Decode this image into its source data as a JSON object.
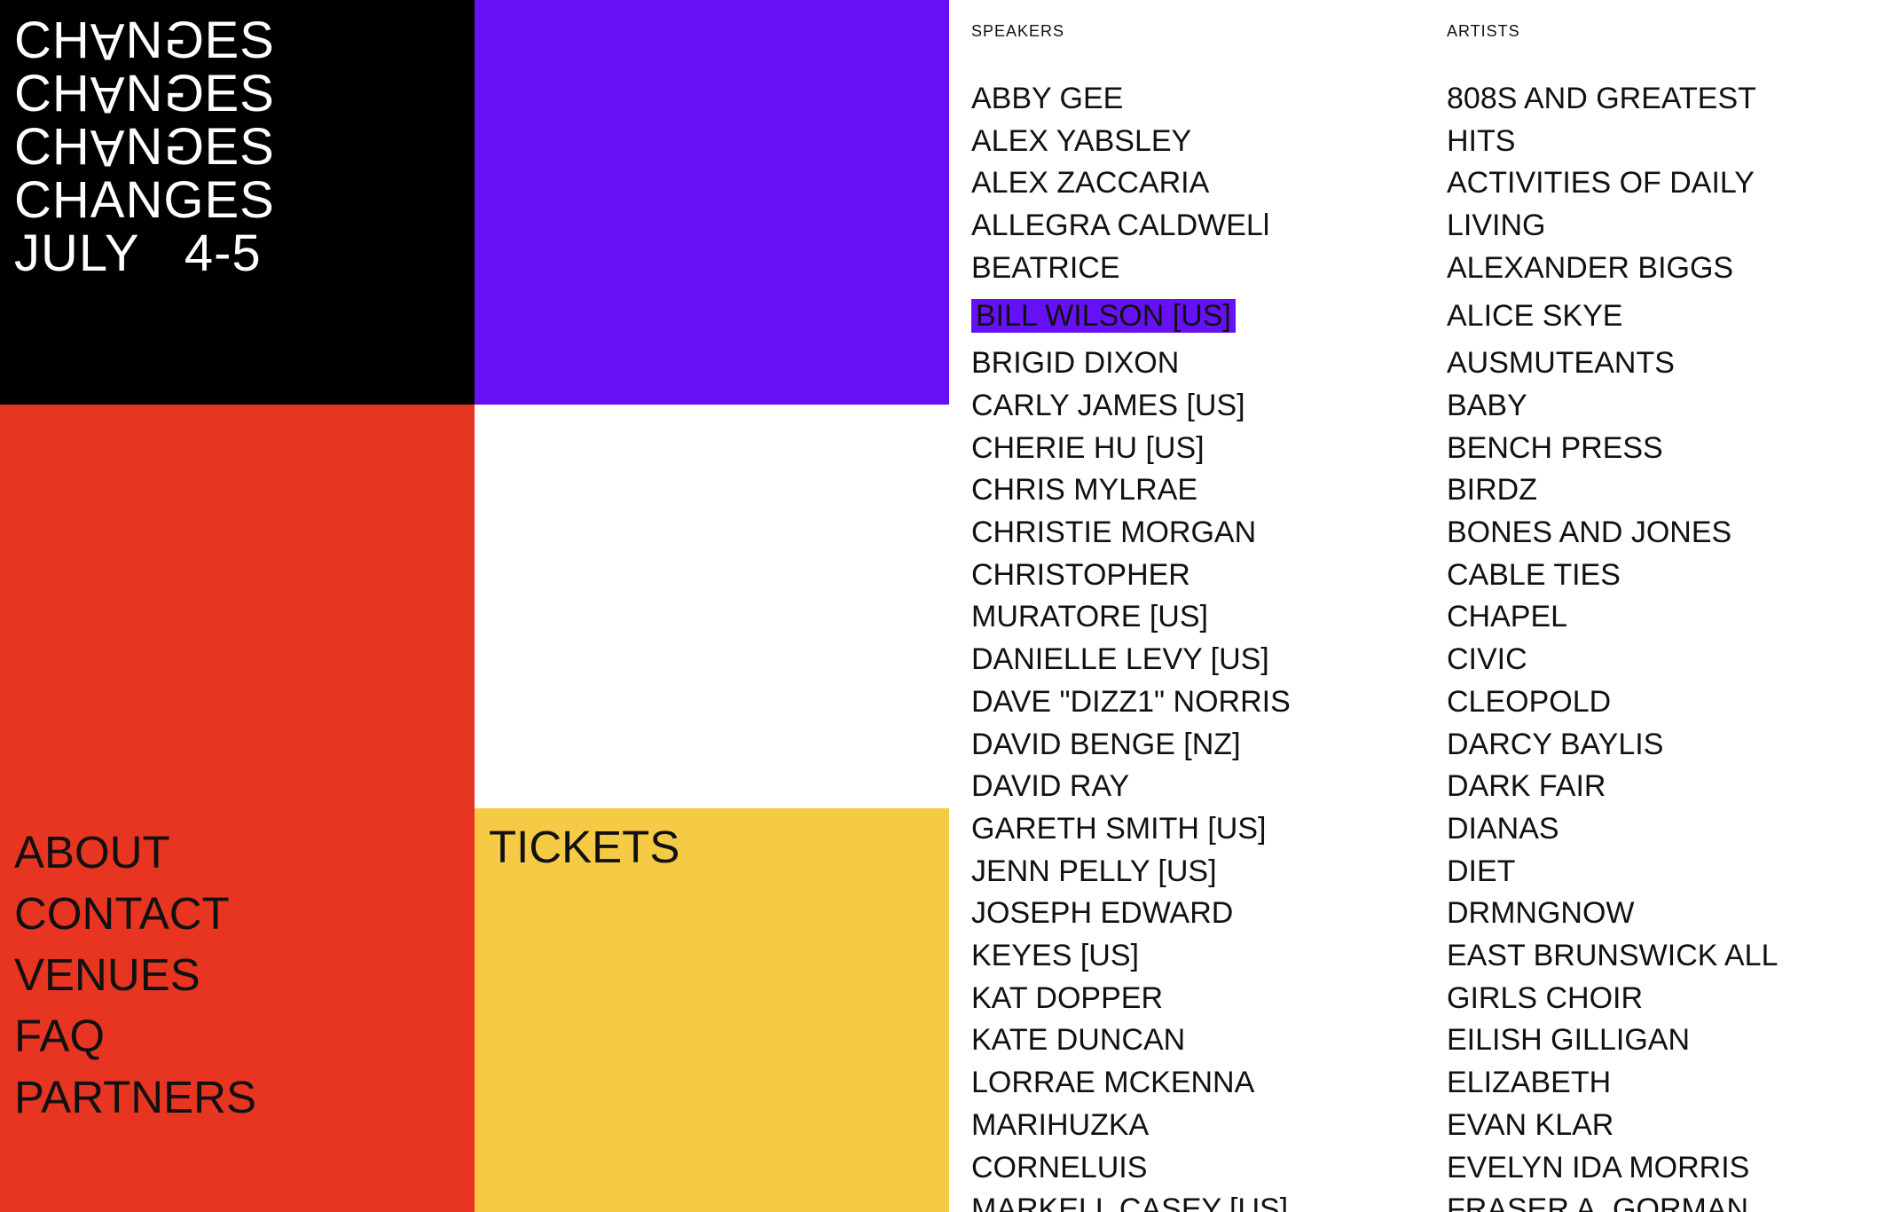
{
  "logo": {
    "line1": "CH",
    "line1_rot_a": "A",
    "line1_mid": "N",
    "line1_rot_g": "G",
    "line1_end": "ES",
    "line2": "CH",
    "line2_rot_a": "A",
    "line2_mid": "N",
    "line2_rot_g": "G",
    "line2_end": "ES",
    "line3": "CH",
    "line3_rot_a": "A",
    "line3_mid": "N",
    "line3_rot_g": "G",
    "line3_end": "ES",
    "line4": "CHANGES",
    "dates": "JULY   4-5"
  },
  "nav": {
    "items": [
      {
        "label": "ABOUT"
      },
      {
        "label": "CONTACT"
      },
      {
        "label": "VENUES"
      },
      {
        "label": "FAQ"
      },
      {
        "label": "PARTNERS"
      }
    ]
  },
  "tickets": {
    "label": "TICKETS"
  },
  "speakers": {
    "heading": "SPEAKERS",
    "items": [
      "ABBY GEE",
      "ALEX YABSLEY",
      "ALEX ZACCARIA",
      "ALLEGRA CALDWELl",
      "BEATRICE",
      "BILL WILSON [US]",
      "BRIGID DIXON",
      "CARLY JAMES [US]",
      "CHERIE HU [US]",
      "CHRIS MYLRAE",
      "CHRISTIE MORGAN",
      "CHRISTOPHER",
      "MURATORE [US]",
      "DANIELLE LEVY [US]",
      "DAVE \"DIZZ1\" NORRIS",
      "DAVID BENGE [NZ]",
      "DAVID RAY",
      "GARETH SMITH [US]",
      "JENN PELLY [US]",
      "JOSEPH EDWARD",
      "KEYES [US]",
      "KAT DOPPER",
      "KATE DUNCAN",
      "LORRAE MCKENNA",
      "MARIHUZKA",
      "CORNELUIS",
      "MARKELL CASEY [US]"
    ]
  },
  "artists": {
    "heading": "ARTISTS",
    "items": [
      "808S AND GREATEST",
      "HITS",
      "ACTIVITIES OF DAILY",
      "LIVING",
      "ALEXANDER BIGGS",
      " ALICE SKYE",
      "AUSMUTEANTS",
      "BABY",
      "BENCH PRESS",
      "BIRDZ",
      "BONES AND JONES",
      "CABLE TIES",
      "CHAPEL",
      "CIVIC",
      "CLEOPOLD",
      "DARCY BAYLIS",
      "DARK FAIR",
      "DIANAS",
      "DIET",
      "DRMNGNOW",
      "EAST BRUNSWICK ALL",
      "GIRLS CHOIR",
      "EILISH GILLIGAN",
      "ELIZABETH",
      "EVAN KLAR",
      "EVELYN IDA MORRIS",
      "FRASER A. GORMAN"
    ]
  },
  "colors": {
    "black": "#000000",
    "purple": "#6611f5",
    "red": "#e83522",
    "yellow": "#f5ca45",
    "white": "#ffffff"
  }
}
